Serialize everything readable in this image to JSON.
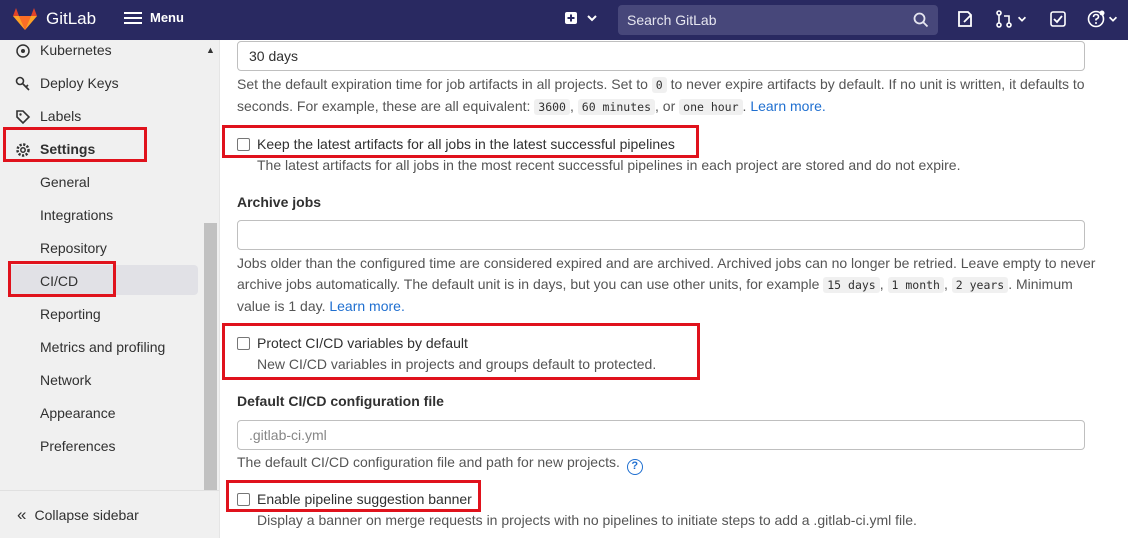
{
  "topbar": {
    "brand": "GitLab",
    "menu_label": "Menu",
    "search_placeholder": "Search GitLab"
  },
  "sidebar": {
    "items": [
      {
        "label": "Kubernetes",
        "icon": "kubernetes-icon"
      },
      {
        "label": "Deploy Keys",
        "icon": "key-icon"
      },
      {
        "label": "Labels",
        "icon": "label-icon"
      },
      {
        "label": "Settings",
        "icon": "gear-icon"
      },
      {
        "label": "General"
      },
      {
        "label": "Integrations"
      },
      {
        "label": "Repository"
      },
      {
        "label": "CI/CD"
      },
      {
        "label": "Reporting"
      },
      {
        "label": "Metrics and profiling"
      },
      {
        "label": "Network"
      },
      {
        "label": "Appearance"
      },
      {
        "label": "Preferences"
      }
    ],
    "collapse_label": "Collapse sidebar"
  },
  "main": {
    "artifacts_expire": {
      "value": "30 days",
      "help_part1": "Set the default expiration time for job artifacts in all projects. Set to",
      "code_zero": "0",
      "help_part2": "to never expire artifacts by default. If no unit is written, it defaults to seconds. For example, these are all equivalent:",
      "code_a": "3600",
      "code_b": "60 minutes",
      "or": ", or",
      "code_c": "one hour",
      "learn_more": "Learn more."
    },
    "keep_latest": {
      "label": "Keep the latest artifacts for all jobs in the latest successful pipelines",
      "help": "The latest artifacts for all jobs in the most recent successful pipelines in each project are stored and do not expire."
    },
    "archive_jobs": {
      "label": "Archive jobs",
      "value": "",
      "help_part1": "Jobs older than the configured time are considered expired and are archived. Archived jobs can no longer be retried. Leave empty to never archive jobs automatically. The default unit is in days, but you can use other units, for example",
      "code_a": "15 days",
      "code_b": "1 month",
      "code_c": "2 years",
      "help_part2": ". Minimum value is 1 day.",
      "learn_more": "Learn more."
    },
    "protect_vars": {
      "label": "Protect CI/CD variables by default",
      "help": "New CI/CD variables in projects and groups default to protected."
    },
    "default_config": {
      "label": "Default CI/CD configuration file",
      "placeholder": ".gitlab-ci.yml",
      "help": "The default CI/CD configuration file and path for new projects."
    },
    "suggestion_banner": {
      "label": "Enable pipeline suggestion banner",
      "help": "Display a banner on merge requests in projects with no pipelines to initiate steps to add a .gitlab-ci.yml file."
    }
  },
  "colors": {
    "topbar": "#292961",
    "highlight": "#e0121c",
    "link": "#1f6fd0"
  }
}
